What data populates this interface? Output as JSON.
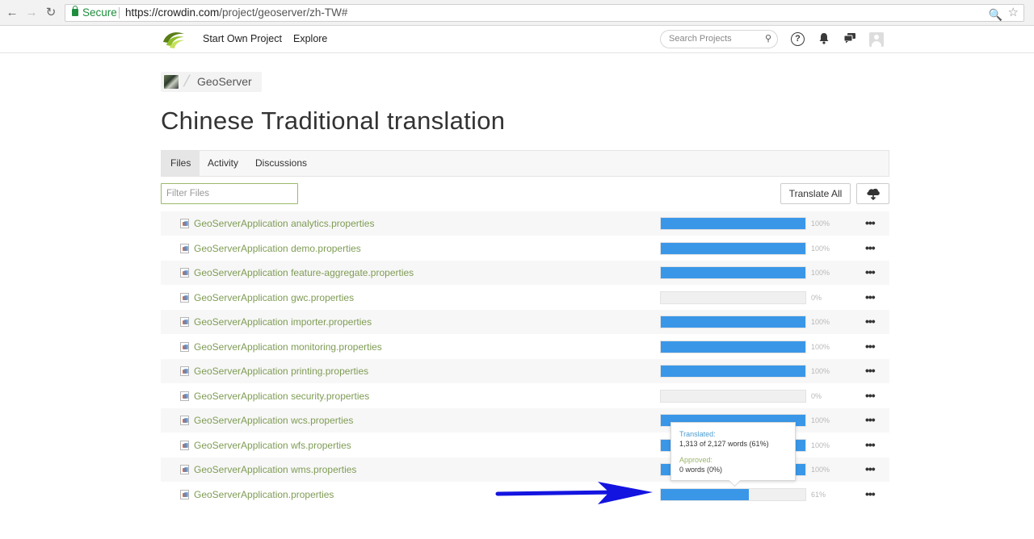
{
  "browser": {
    "secure_label": "Secure",
    "url_host": "https://crowdin.com",
    "url_path": "/project/geoserver/zh-TW#"
  },
  "header": {
    "nav": [
      "Start Own Project",
      "Explore"
    ],
    "search_placeholder": "Search Projects"
  },
  "breadcrumb": {
    "project": "GeoServer"
  },
  "page_title": "Chinese Traditional translation",
  "tabs": [
    {
      "label": "Files",
      "active": true
    },
    {
      "label": "Activity",
      "active": false
    },
    {
      "label": "Discussions",
      "active": false
    }
  ],
  "toolbar": {
    "filter_placeholder": "Filter Files",
    "translate_all_label": "Translate All"
  },
  "files": [
    {
      "name": "GeoServerApplication analytics.properties",
      "progress": 100,
      "pct_label": "100%"
    },
    {
      "name": "GeoServerApplication demo.properties",
      "progress": 100,
      "pct_label": "100%"
    },
    {
      "name": "GeoServerApplication feature-aggregate.properties",
      "progress": 100,
      "pct_label": "100%"
    },
    {
      "name": "GeoServerApplication gwc.properties",
      "progress": 0,
      "pct_label": "0%"
    },
    {
      "name": "GeoServerApplication importer.properties",
      "progress": 100,
      "pct_label": "100%"
    },
    {
      "name": "GeoServerApplication monitoring.properties",
      "progress": 100,
      "pct_label": "100%"
    },
    {
      "name": "GeoServerApplication printing.properties",
      "progress": 100,
      "pct_label": "100%"
    },
    {
      "name": "GeoServerApplication security.properties",
      "progress": 0,
      "pct_label": "0%"
    },
    {
      "name": "GeoServerApplication wcs.properties",
      "progress": 100,
      "pct_label": "100%"
    },
    {
      "name": "GeoServerApplication wfs.properties",
      "progress": 100,
      "pct_label": "100%"
    },
    {
      "name": "GeoServerApplication wms.properties",
      "progress": 100,
      "pct_label": "100%"
    },
    {
      "name": "GeoServerApplication.properties",
      "progress": 61,
      "pct_label": "61%"
    }
  ],
  "tooltip": {
    "translated_label": "Translated:",
    "translated_value": "1,313 of 2,127 words (61%)",
    "approved_label": "Approved:",
    "approved_value": "0 words (0%)"
  },
  "colors": {
    "progress": "#3a97e8",
    "file_link": "#7f9c55",
    "translated_label": "#4a9bd0",
    "approved_label": "#9bb46a",
    "annotation_arrow": "#1414e0"
  }
}
